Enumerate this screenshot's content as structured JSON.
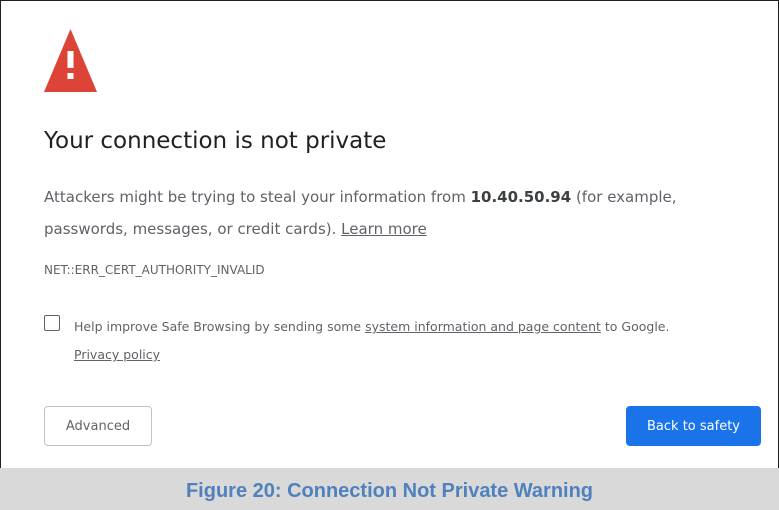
{
  "interstitial": {
    "icon": "warning-triangle-icon",
    "title": "Your connection is not private",
    "description": {
      "before_host": "Attackers might be trying to steal your information from ",
      "host": "10.40.50.94",
      "after_host": " (for example, passwords, messages, or credit cards). ",
      "learn_more": "Learn more"
    },
    "error_code": "NET::ERR_CERT_AUTHORITY_INVALID",
    "safe_browsing": {
      "before_link": "Help improve Safe Browsing by sending some ",
      "link": "system information and page content",
      "after_link": " to Google.",
      "privacy_policy": "Privacy policy"
    },
    "buttons": {
      "advanced": "Advanced",
      "back": "Back to safety"
    }
  },
  "caption": "Figure 20: Connection Not Private Warning",
  "colors": {
    "warning": "#db4437",
    "primary_button": "#1a73e8",
    "caption_text": "#4f81bd",
    "caption_bar": "#d9d9d9"
  }
}
